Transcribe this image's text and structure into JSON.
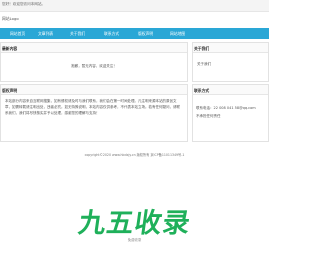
{
  "topbar": {
    "text": "您好！欢迎您访问本网站。"
  },
  "logo": {
    "text": "网站Logo"
  },
  "nav": {
    "items": [
      "网站首页",
      "文章列表",
      "关于我们",
      "联系方式",
      "版权声明",
      "网站地图"
    ]
  },
  "left_panel_1": {
    "title": "最新内容",
    "message": "抱歉，暂无内容，欢迎关注！"
  },
  "right_panel_1": {
    "title": "关于我们",
    "link": "关于我们"
  },
  "left_panel_2": {
    "title": "版权声明",
    "paragraph": "本站部分内容来自互联网搜集，如有侵权请及时与我们联系，我们会在第一时间处理。凡注明来源本站的原创文章，如需转载请注明出处，违者必究。如无特殊说明，本站内容仅供参考，不代表本站立场。若有任何疑问，请联系我们，我们将尽快核实并予以处理，感谢您的理解与支持！"
  },
  "right_panel_2": {
    "title": "联系方式",
    "phone": "联系电话：22 008 041  58@qq.com",
    "note": "不承担任何责任"
  },
  "footer": {
    "text": "copyright©2020 www.hbdxjy.cn 版权所有    京ICP备11011349号-1"
  },
  "brand": {
    "name": "九五收录",
    "sub": "免费收录"
  }
}
